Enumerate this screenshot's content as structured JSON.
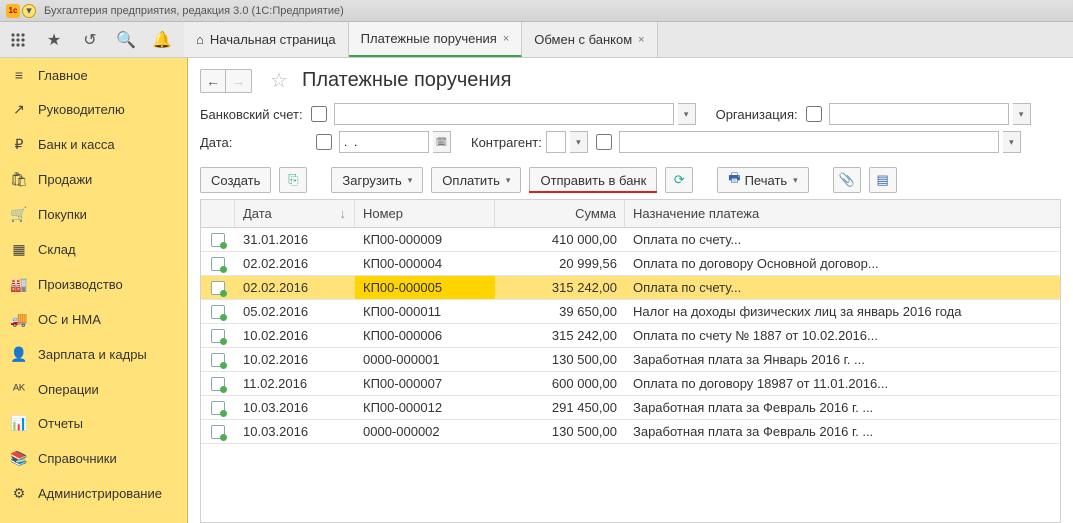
{
  "app_title": "Бухгалтерия предприятия, редакция 3.0  (1С:Предприятие)",
  "tabs": [
    {
      "label": "Начальная страница",
      "closable": false,
      "has_home": true
    },
    {
      "label": "Платежные поручения",
      "closable": true,
      "active": true
    },
    {
      "label": "Обмен с банком",
      "closable": true
    }
  ],
  "sidebar": [
    {
      "icon": "≡",
      "label": "Главное"
    },
    {
      "icon": "↗",
      "label": "Руководителю"
    },
    {
      "icon": "₽",
      "label": "Банк и касса"
    },
    {
      "icon": "🛍",
      "label": "Продажи"
    },
    {
      "icon": "🛒",
      "label": "Покупки"
    },
    {
      "icon": "▦",
      "label": "Склад"
    },
    {
      "icon": "🏭",
      "label": "Производство"
    },
    {
      "icon": "🚚",
      "label": "ОС и НМА"
    },
    {
      "icon": "👤",
      "label": "Зарплата и кадры"
    },
    {
      "icon": "ᴬᴷ",
      "label": "Операции"
    },
    {
      "icon": "📊",
      "label": "Отчеты"
    },
    {
      "icon": "📚",
      "label": "Справочники"
    },
    {
      "icon": "⚙",
      "label": "Администрирование"
    }
  ],
  "page": {
    "title": "Платежные поручения",
    "filters": {
      "bank_account_label": "Банковский счет:",
      "org_label": "Организация:",
      "date_label": "Дата:",
      "date_value": ".  .",
      "counterparty_label": "Контрагент:"
    },
    "actions": {
      "create": "Создать",
      "load": "Загрузить",
      "pay": "Оплатить",
      "send_bank": "Отправить в банк",
      "print": "Печать"
    },
    "columns": {
      "date": "Дата",
      "number": "Номер",
      "sum": "Сумма",
      "desc": "Назначение платежа"
    },
    "rows": [
      {
        "date": "31.01.2016",
        "number": "КП00-000009",
        "sum": "410 000,00",
        "desc": "Оплата по счету..."
      },
      {
        "date": "02.02.2016",
        "number": "КП00-000004",
        "sum": "20 999,56",
        "desc": "Оплата по договору Основной договор..."
      },
      {
        "date": "02.02.2016",
        "number": "КП00-000005",
        "sum": "315 242,00",
        "desc": "Оплата по счету...",
        "selected": true
      },
      {
        "date": "05.02.2016",
        "number": "КП00-000011",
        "sum": "39 650,00",
        "desc": "Налог на доходы физических лиц за январь 2016 года"
      },
      {
        "date": "10.02.2016",
        "number": "КП00-000006",
        "sum": "315 242,00",
        "desc": "Оплата по счету № 1887 от 10.02.2016..."
      },
      {
        "date": "10.02.2016",
        "number": "0000-000001",
        "sum": "130 500,00",
        "desc": "Заработная плата за Январь 2016 г. ..."
      },
      {
        "date": "11.02.2016",
        "number": "КП00-000007",
        "sum": "600 000,00",
        "desc": "Оплата по договору 18987 от 11.01.2016..."
      },
      {
        "date": "10.03.2016",
        "number": "КП00-000012",
        "sum": "291 450,00",
        "desc": "Заработная плата за Февраль 2016 г. ..."
      },
      {
        "date": "10.03.2016",
        "number": "0000-000002",
        "sum": "130 500,00",
        "desc": "Заработная плата за Февраль 2016 г. ..."
      }
    ]
  }
}
